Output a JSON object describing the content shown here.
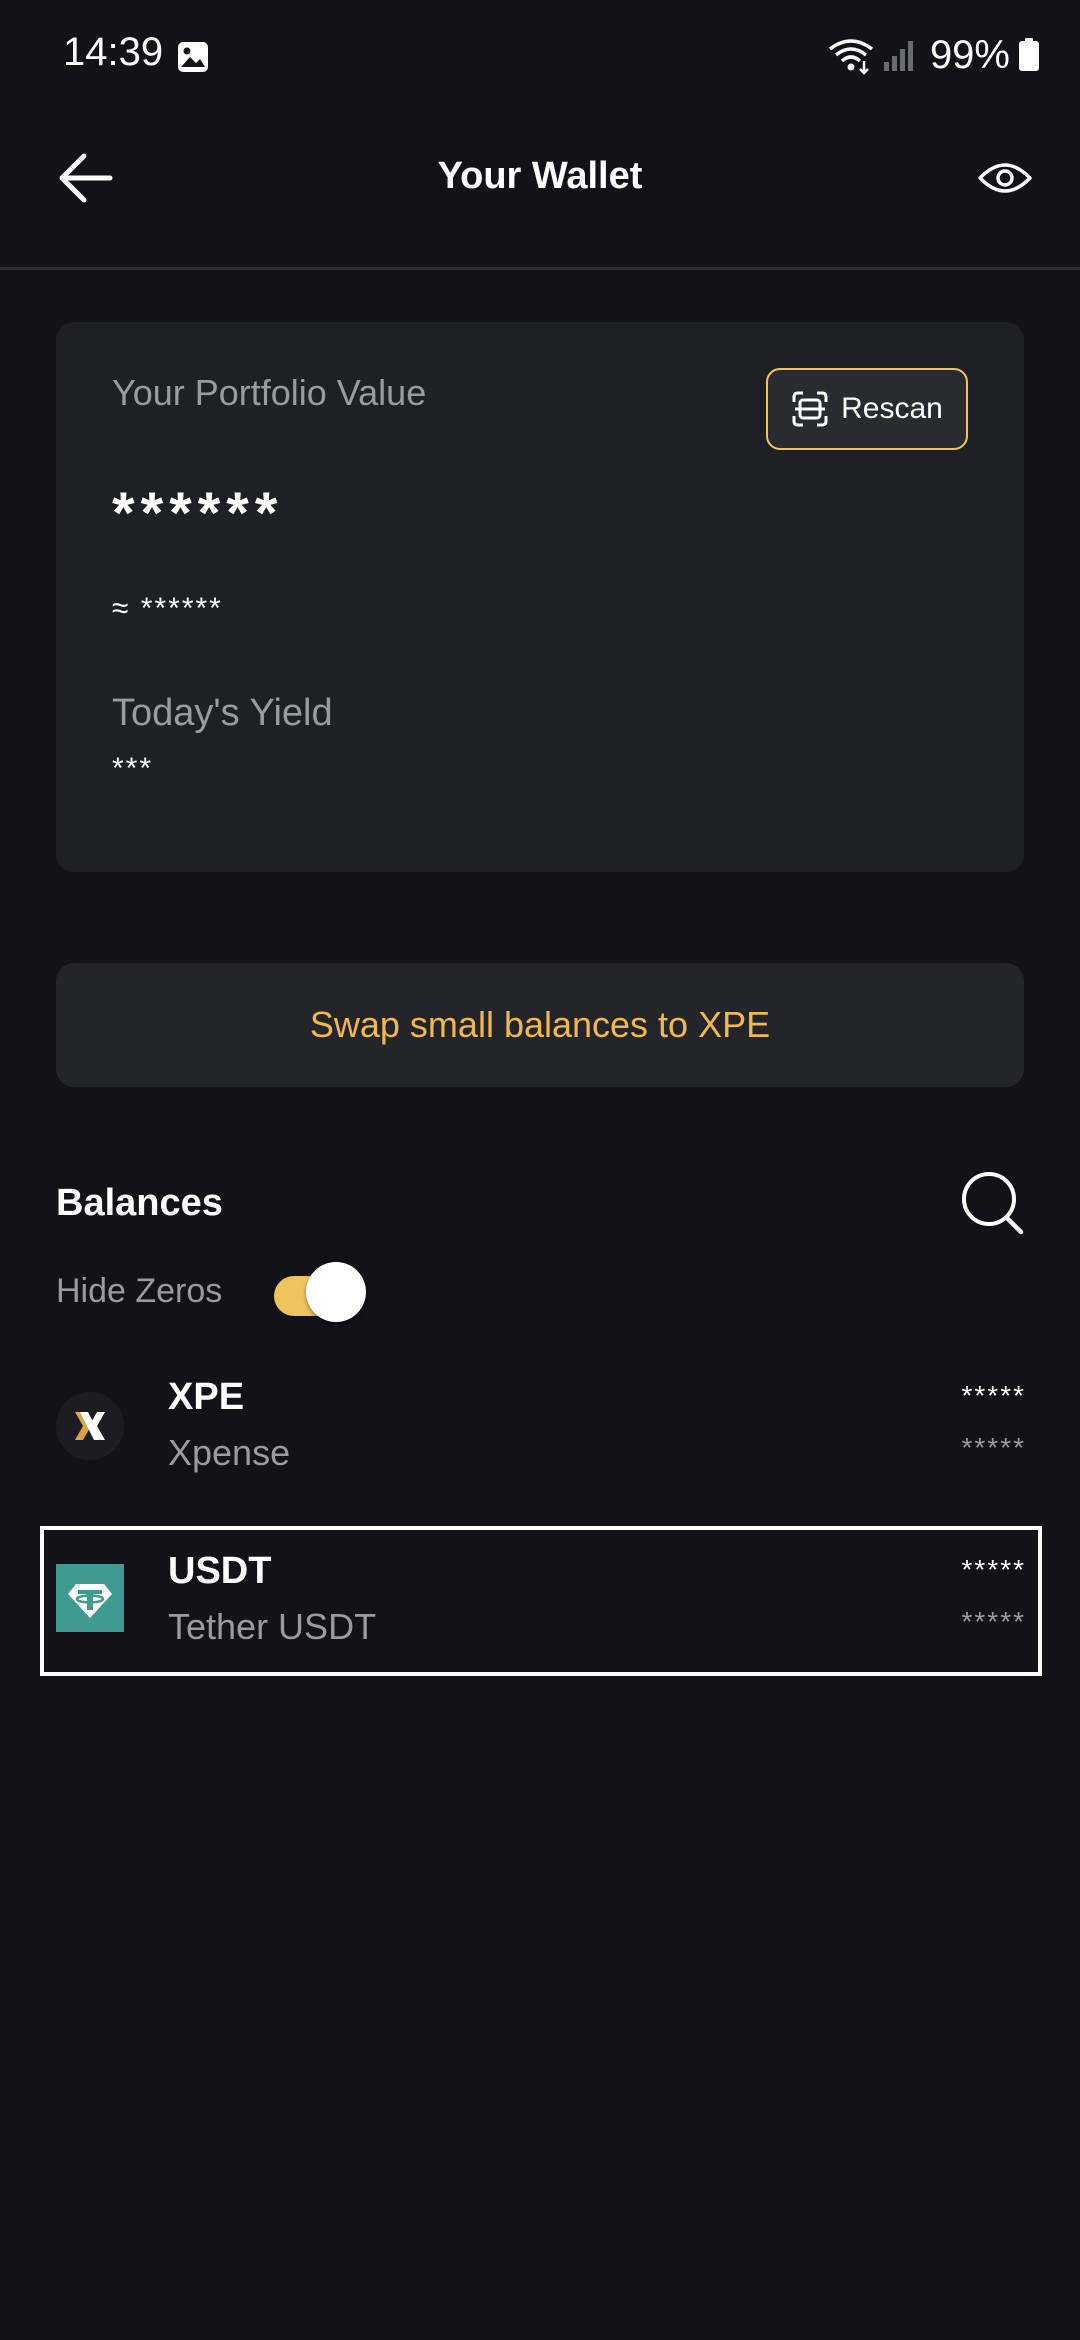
{
  "status_bar": {
    "time": "14:39",
    "battery": "99%",
    "icons": [
      "gallery-icon",
      "wifi-icon",
      "signal-icon",
      "battery-icon"
    ]
  },
  "header": {
    "title": "Your Wallet",
    "back_icon": "arrow-left-icon",
    "visibility_icon": "eye-icon"
  },
  "portfolio": {
    "label": "Your Portfolio Value",
    "rescan_label": "Rescan",
    "rescan_icon": "scan-icon",
    "value": "******",
    "approx_value": "≈ ******",
    "yield_label": "Today's Yield",
    "yield_value": "***"
  },
  "swap": {
    "label": "Swap small balances to XPE"
  },
  "balances": {
    "heading": "Balances",
    "search_icon": "search-icon",
    "hide_zeros_label": "Hide Zeros",
    "hide_zeros_enabled": true,
    "tokens": [
      {
        "symbol": "XPE",
        "name": "Xpense",
        "amount": "*****",
        "value": "*****",
        "logo": "xpe-logo"
      },
      {
        "symbol": "USDT",
        "name": "Tether USDT",
        "amount": "*****",
        "value": "*****",
        "logo": "tether-logo"
      }
    ]
  },
  "colors": {
    "background": "#121218",
    "card": "#1f2026",
    "accent": "#f0c45d",
    "swap_text": "#f0b850",
    "tether": "#3f9a8f"
  }
}
